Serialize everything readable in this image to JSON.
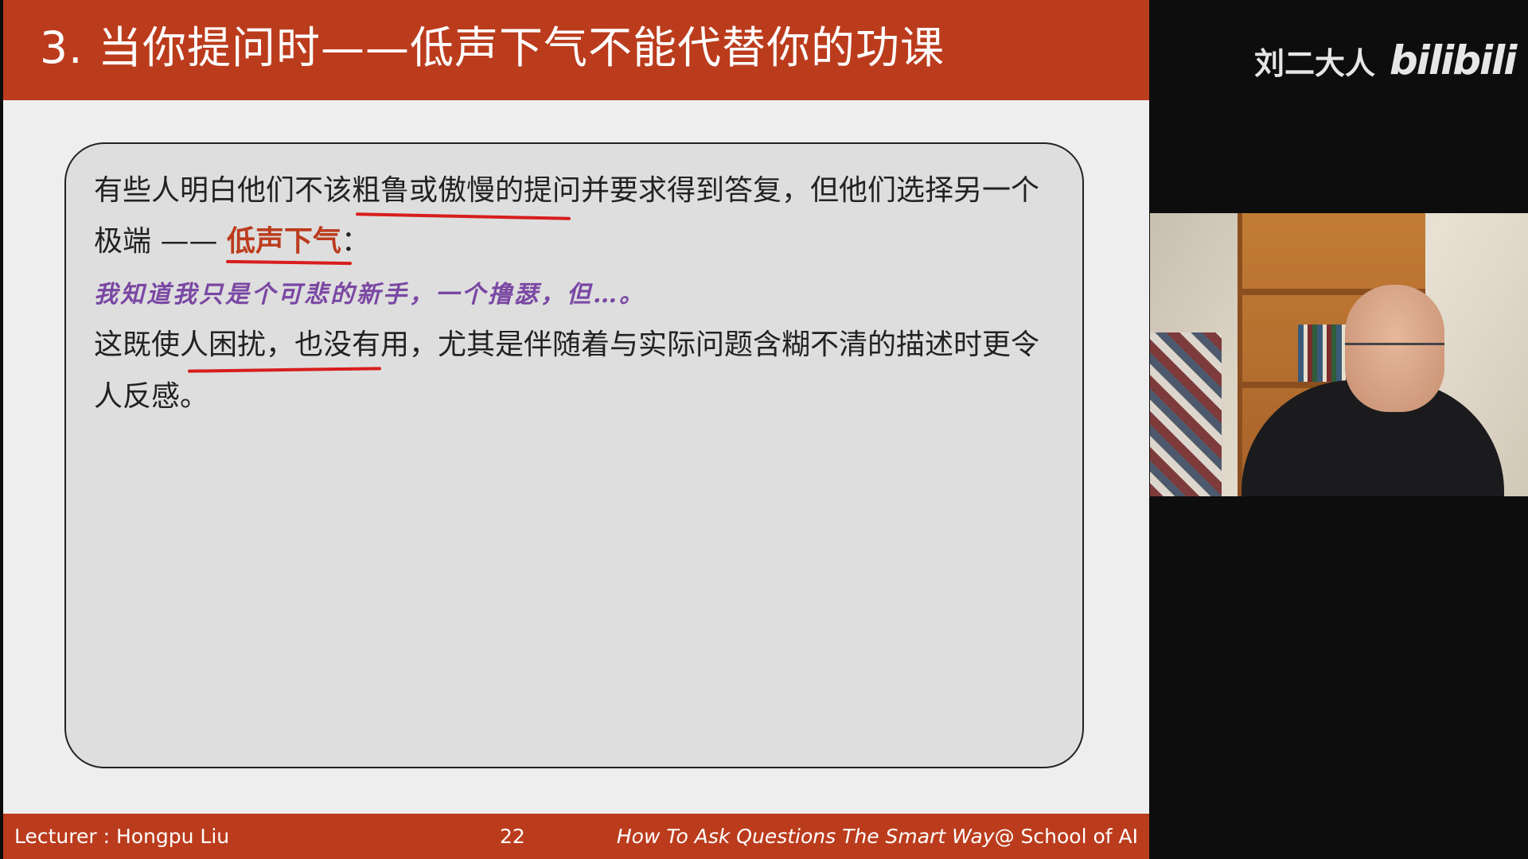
{
  "slide": {
    "title": "3. 当你提问时——低声下气不能代替你的功课",
    "line1": "有些人明白他们不该粗鲁或傲慢的提问并要求得到答复，但他们选择另一个",
    "line2_prefix": "极端 —— ",
    "line2_highlight": "低声下气",
    "line2_suffix": "：",
    "line3": "我知道我只是个可悲的新手，一个撸瑟，但…。",
    "line4": "这既使人困扰，也没有用，尤其是伴随着与实际问题含糊不清的描述时更令",
    "line5": "人反感。",
    "colors": {
      "accent": "#bb3c1d",
      "quote": "#7a47a3",
      "annotation": "#d81d1d"
    }
  },
  "footer": {
    "lecturer": "Lecturer : Hongpu Liu",
    "page": "22",
    "course_italic": "How To Ask Questions The Smart Way",
    "course_rest": "@ School of AI"
  },
  "watermark": {
    "channel": "刘二大人",
    "brand": "bilibili"
  }
}
